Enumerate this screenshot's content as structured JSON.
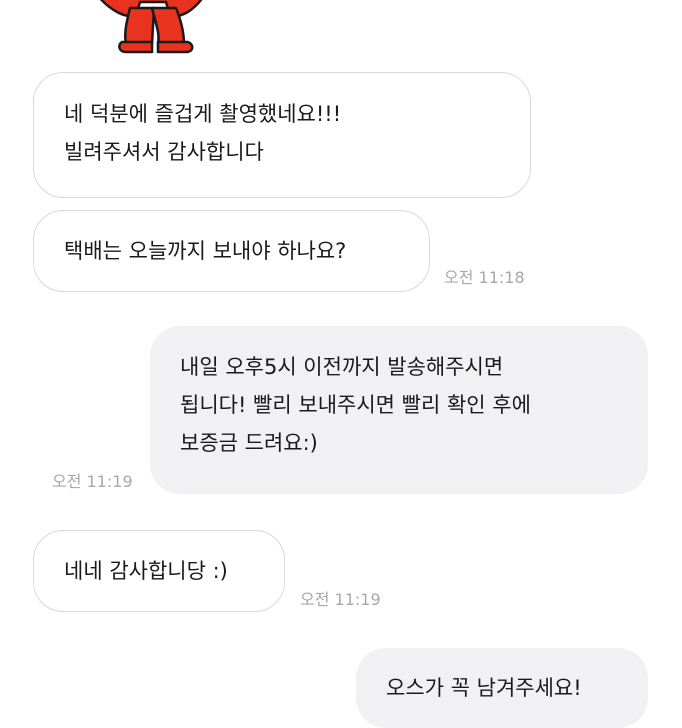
{
  "messages": [
    {
      "direction": "incoming",
      "lines": [
        "네 덕분에 즐겁게 촬영했네요!!!",
        "빌려주셔서 감사합니다"
      ],
      "time": ""
    },
    {
      "direction": "incoming",
      "lines": [
        "택배는 오늘까지 보내야 하나요?"
      ],
      "time": "오전 11:18"
    },
    {
      "direction": "outgoing",
      "lines": [
        "내일 오후5시 이전까지 발송해주시면",
        "됩니다! 빨리 보내주시면 빨리 확인 후에",
        "보증금 드려요:)"
      ],
      "time": "오전 11:19"
    },
    {
      "direction": "incoming",
      "lines": [
        "네네 감사합니당 :)"
      ],
      "time": "오전 11:19"
    },
    {
      "direction": "outgoing",
      "lines": [
        "오스가 꼭 남겨주세요!"
      ],
      "time": ""
    }
  ],
  "colors": {
    "sticker_red": "#e8331f",
    "incoming_bubble_border": "#d9d9d9",
    "outgoing_bubble_bg": "#f1f1f3",
    "timestamp": "#a8a8a8"
  },
  "sticker": {
    "icon": "red-character-sticker"
  }
}
